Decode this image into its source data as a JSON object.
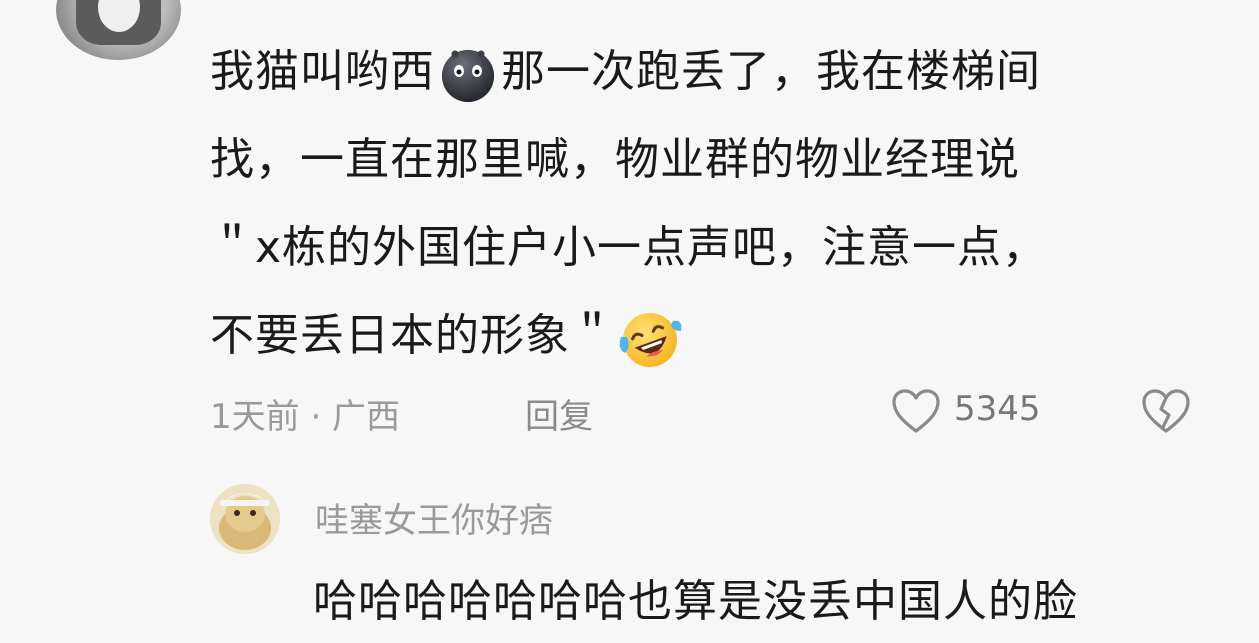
{
  "comment": {
    "lines": [
      {
        "before": "我猫叫哟西",
        "emoji": "dark-face-emoji",
        "after": "那一次跑丢了，我在楼梯间"
      },
      {
        "text": "找，一直在那里喊，物业群的物业经理说"
      },
      {
        "text": "＂x栋的外国住户小一点声吧，注意一点，"
      },
      {
        "text": "不要丢日本的形象＂",
        "emoji": "laughing-tears-emoji"
      }
    ],
    "meta": "1天前 · 广西",
    "reply_label": "回复",
    "like_count": "5345",
    "like_icon": "heart-outline-icon",
    "dislike_icon": "broken-heart-icon"
  },
  "reply": {
    "author": "哇塞女王你好痞",
    "text": "哈哈哈哈哈哈哈也算是没丢中国人的脸"
  },
  "colors": {
    "background": "#f7f7f7",
    "text": "#1a1a1a",
    "meta": "#9a9a9a"
  }
}
